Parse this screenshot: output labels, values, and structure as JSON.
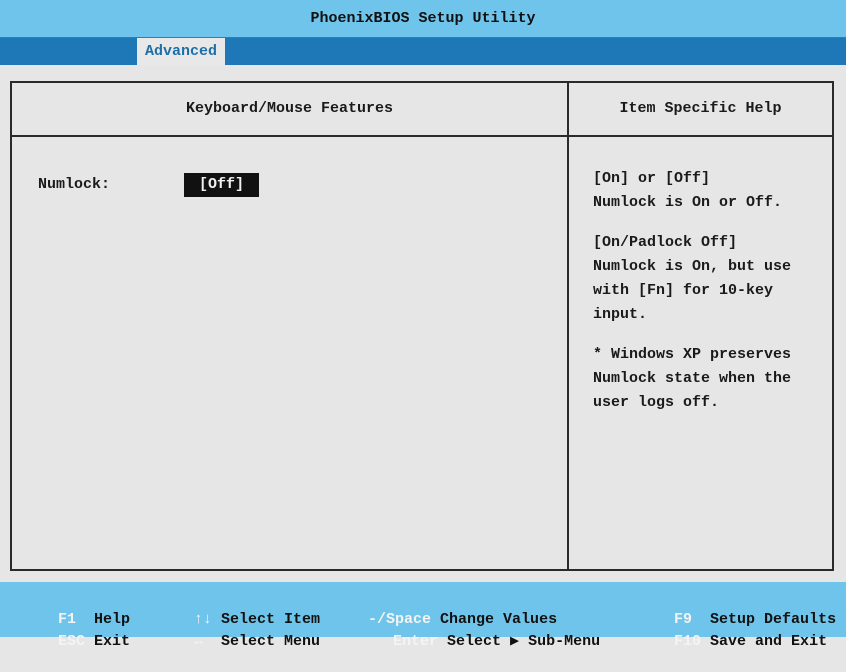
{
  "title": "PhoenixBIOS Setup Utility",
  "tabs": [
    {
      "label": "Advanced",
      "active": true
    }
  ],
  "panel": {
    "header": "Keyboard/Mouse Features",
    "option": {
      "label": "Numlock:",
      "value": "[Off]"
    }
  },
  "help": {
    "header": "Item Specific Help",
    "paragraphs": [
      "[On] or [Off]\nNumlock is On or Off.",
      "[On/Padlock Off]\nNumlock is On, but use\nwith [Fn] for 10-key\ninput.",
      "* Windows XP preserves\nNumlock state when the\nuser logs off."
    ]
  },
  "footer": {
    "items": [
      {
        "key": "F1",
        "text": "Help"
      },
      {
        "key": "ESC",
        "text": "Exit"
      },
      {
        "key": "↑↓",
        "text": "Select Item"
      },
      {
        "key": "↔",
        "text": "Select Menu"
      },
      {
        "key": "-/Space",
        "text": "Change Values"
      },
      {
        "key": "Enter",
        "text": "Select ▶ Sub-Menu"
      },
      {
        "key": "F9",
        "text": "Setup Defaults"
      },
      {
        "key": "F10",
        "text": "Save and Exit"
      }
    ]
  }
}
